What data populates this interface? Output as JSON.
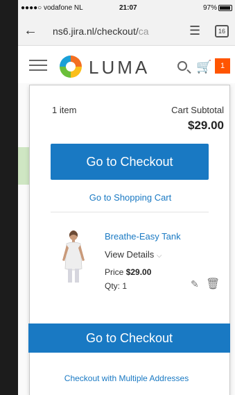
{
  "status_bar": {
    "carrier": "●●●●○ vodafone NL",
    "time": "21:07",
    "battery": "97%"
  },
  "browser": {
    "url_main": "ns6.jira.nl/checkout/",
    "url_faded": "ca",
    "tab_count": "16"
  },
  "header": {
    "logo": "LUMA",
    "cart_count": "1"
  },
  "minicart": {
    "item_count": "1 item",
    "subtotal_label": "Cart Subtotal",
    "subtotal": "$29.00",
    "checkout_button": "Go to Checkout",
    "view_cart_link": "Go to Shopping Cart",
    "product": {
      "name": "Breathe-Easy Tank",
      "details": "View Details",
      "price_label": "Price",
      "price": "$29.00",
      "qty_label": "Qty:",
      "qty": "1"
    }
  },
  "page": {
    "checkout_button": "Go to Checkout",
    "multi_address_link": "Checkout with Multiple Addresses"
  }
}
